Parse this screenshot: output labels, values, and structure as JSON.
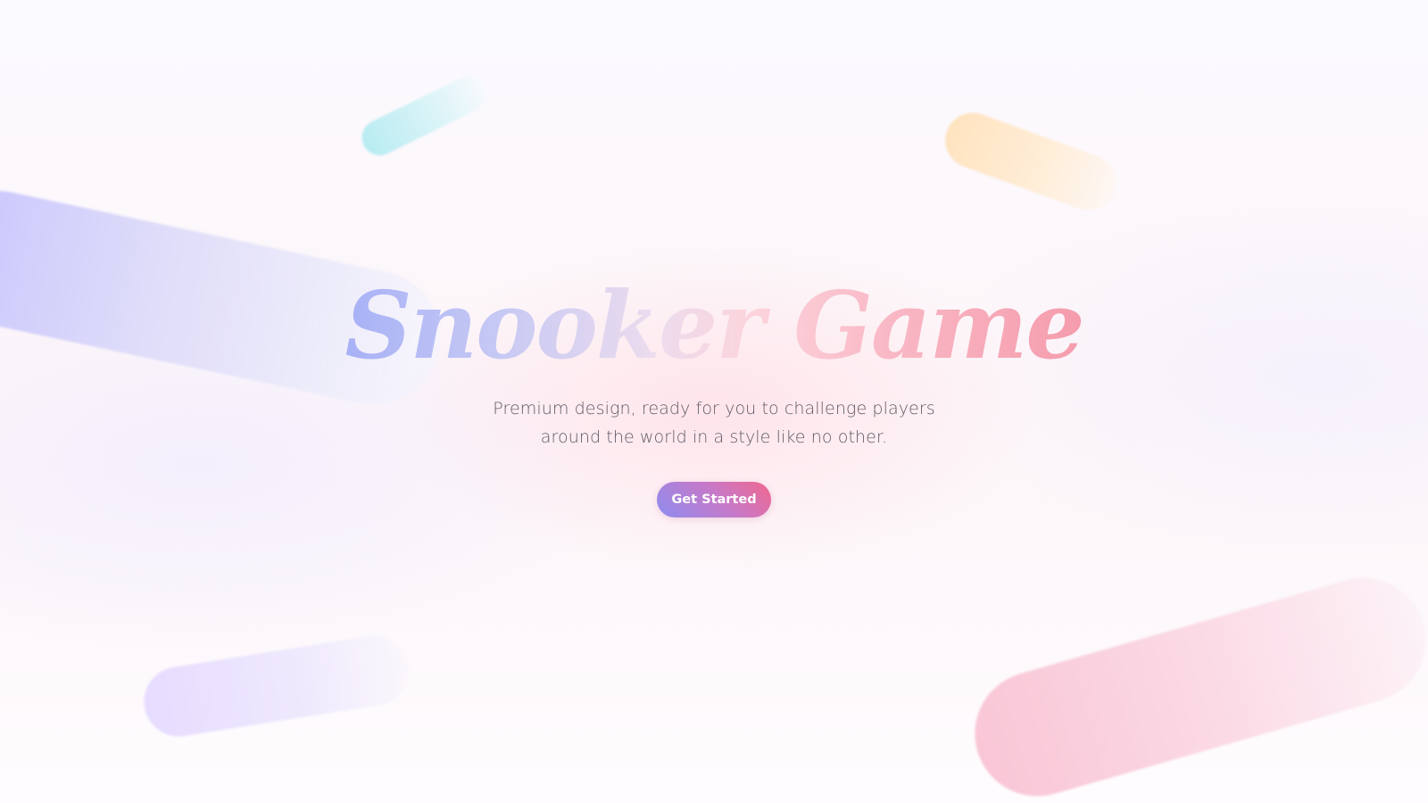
{
  "hero": {
    "title": "Snooker Game",
    "subtitle": "Premium design, ready for you to challenge players around the world in a style like no other.",
    "cta_label": "Get Started"
  },
  "colors": {
    "title_gradient_start": "#a7b1f6",
    "title_gradient_end": "#f59cac",
    "button_gradient_start": "#8e8cf0",
    "button_gradient_end": "#f0678e",
    "subtitle_text": "#5f5a66"
  }
}
